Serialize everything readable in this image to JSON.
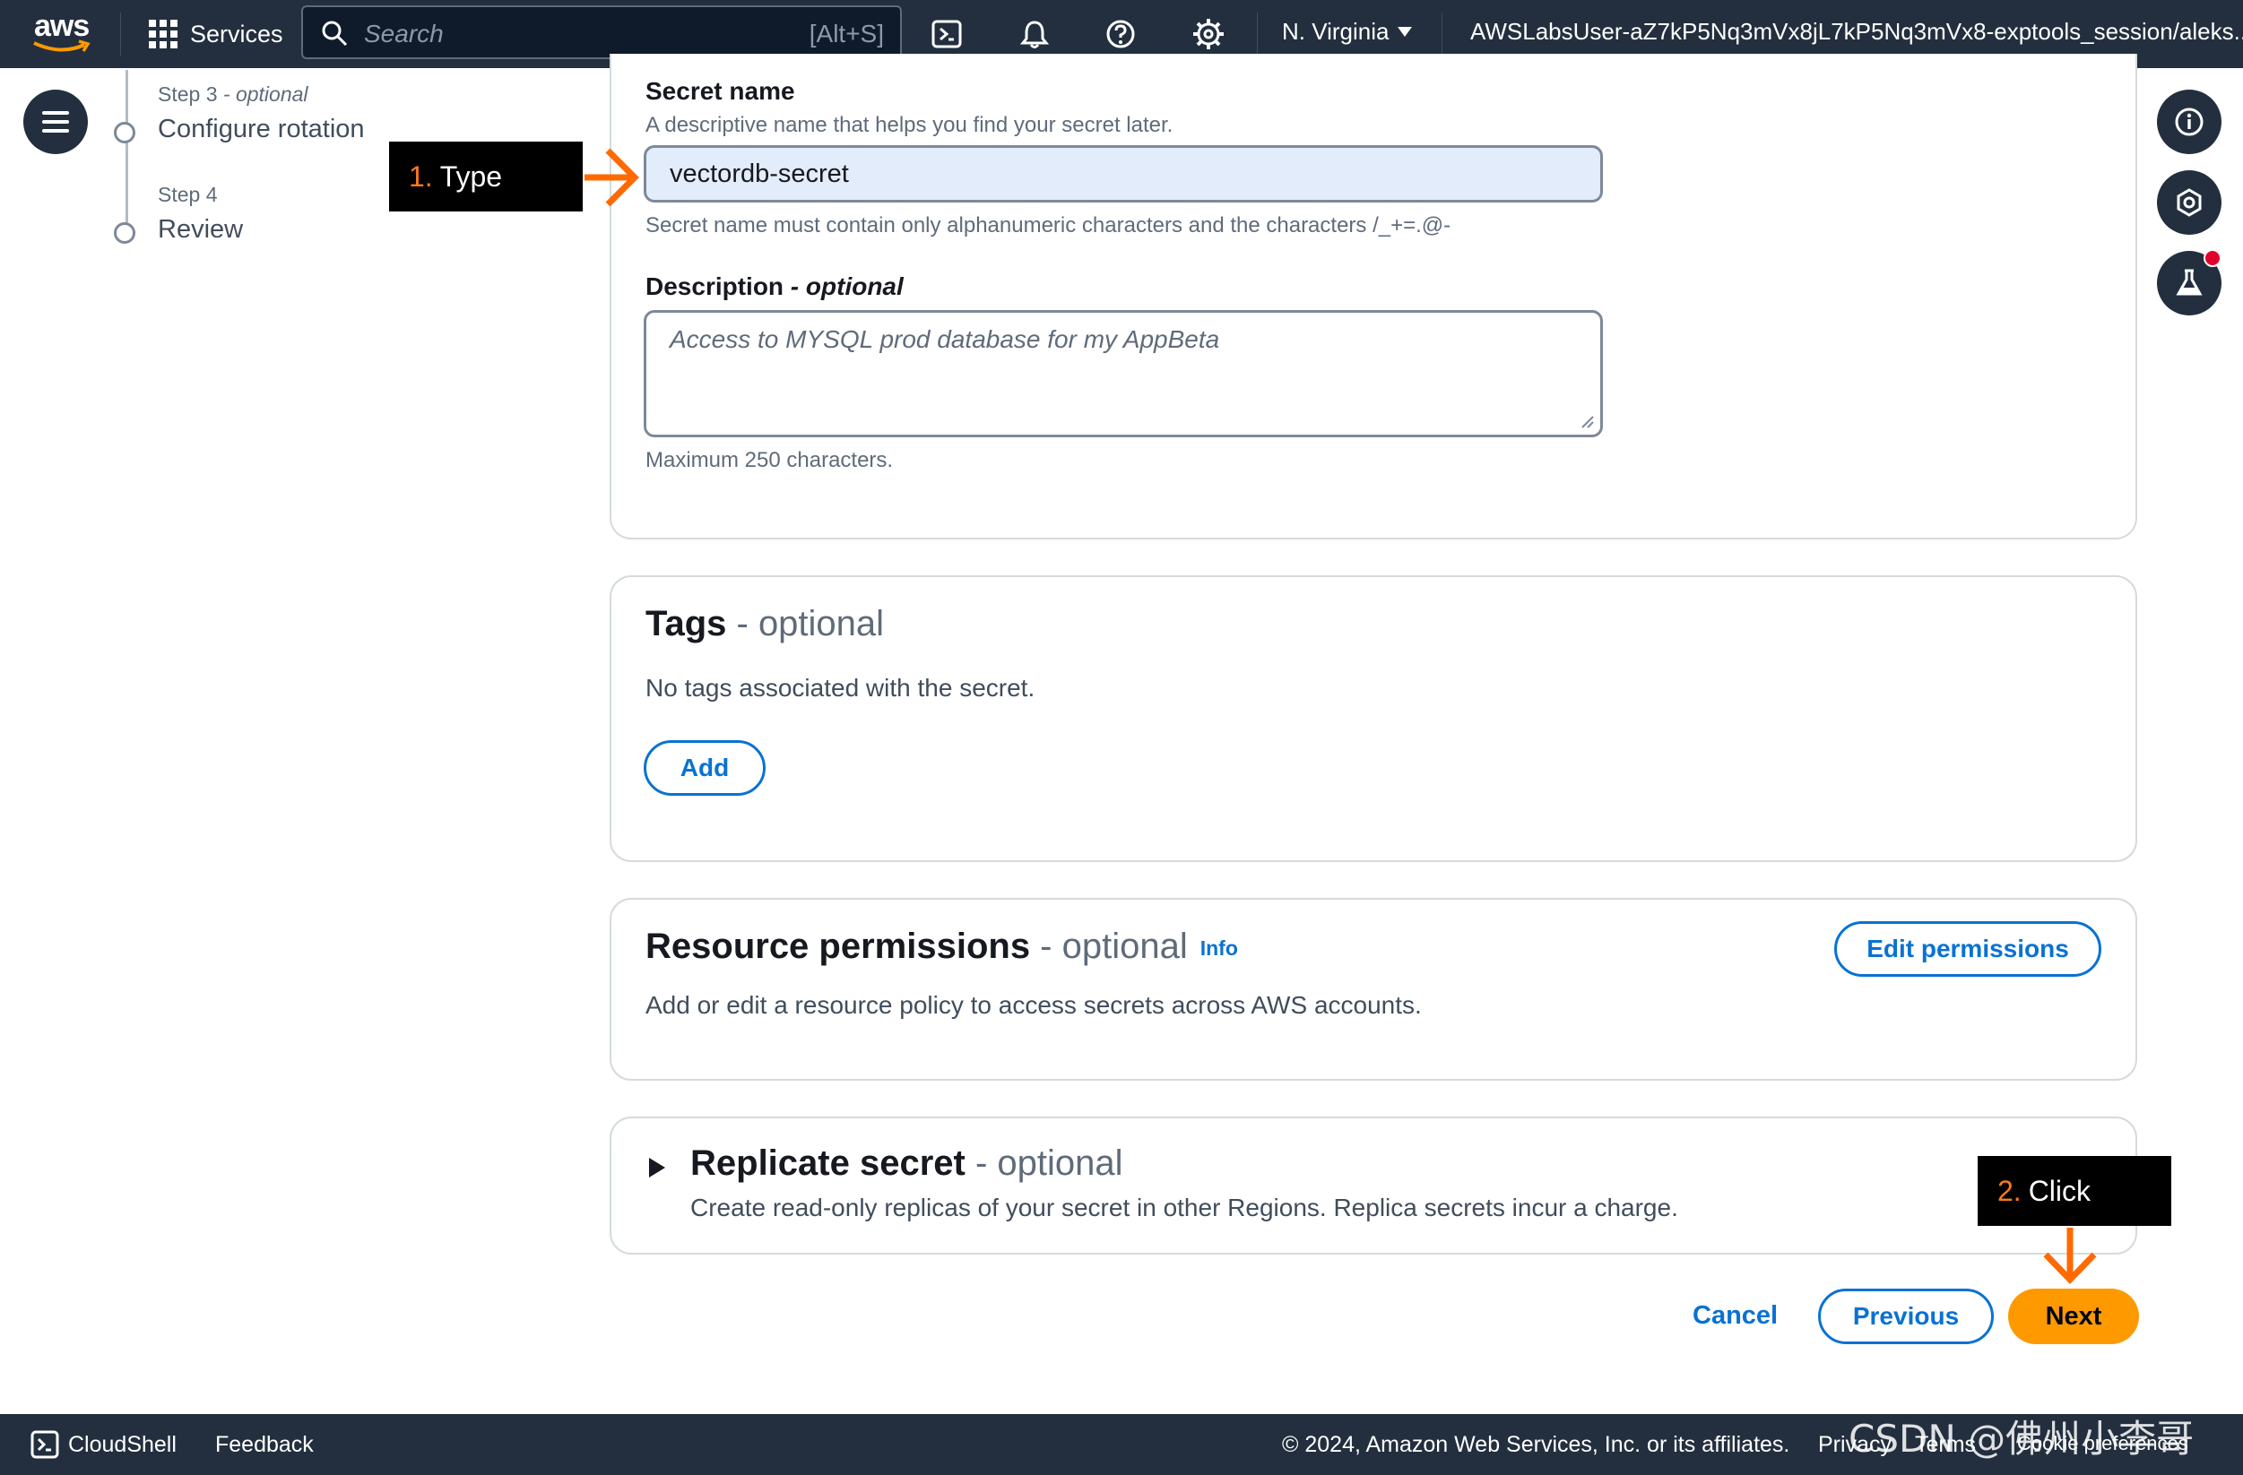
{
  "nav": {
    "logo_text": "aws",
    "services": "Services",
    "search_placeholder": "Search",
    "search_shortcut": "[Alt+S]",
    "region": "N. Virginia",
    "account": "AWSLabsUser-aZ7kP5Nq3mVx8jL7kP5Nq3mVx8-exptools_session/aleks..."
  },
  "steps": [
    {
      "label": "Step 3",
      "optional": " - optional",
      "name": "Configure rotation"
    },
    {
      "label": "Step 4",
      "optional": "",
      "name": "Review"
    }
  ],
  "callouts": {
    "type": {
      "num": "1.",
      "text": "Type"
    },
    "click": {
      "num": "2.",
      "text": "Click"
    }
  },
  "secret_name": {
    "label": "Secret name",
    "description": "A descriptive name that helps you find your secret later.",
    "value": "vectordb-secret",
    "constraint": "Secret name must contain only alphanumeric characters and the characters /_+=.@-"
  },
  "description_field": {
    "label": "Description",
    "optional": " - optional",
    "placeholder": "Access to MYSQL prod database for my AppBeta",
    "hint": "Maximum 250 characters."
  },
  "tags": {
    "title": "Tags",
    "optional": " - optional",
    "body": "No tags associated with the secret.",
    "add_button": "Add"
  },
  "resource_permissions": {
    "title": "Resource permissions",
    "optional": " - optional",
    "info": "Info",
    "body": "Add or edit a resource policy to access secrets across AWS accounts.",
    "edit_button": "Edit permissions"
  },
  "replicate": {
    "title": "Replicate secret",
    "optional": " - optional",
    "body": "Create read-only replicas of your secret in other Regions. Replica secrets incur a charge."
  },
  "actions": {
    "cancel": "Cancel",
    "previous": "Previous",
    "next": "Next"
  },
  "footer": {
    "cloudshell": "CloudShell",
    "feedback": "Feedback",
    "copyright": "© 2024, Amazon Web Services, Inc. or its affiliates.",
    "privacy": "Privacy",
    "terms": "Terms",
    "cookie": "Cookie preferences"
  },
  "watermark": "CSDN @佛州小李哥",
  "colors": {
    "nav_bg": "#232f3e",
    "accent_blue": "#0972d3",
    "primary_orange": "#ff9900",
    "annotation_orange": "#ff6a00"
  }
}
